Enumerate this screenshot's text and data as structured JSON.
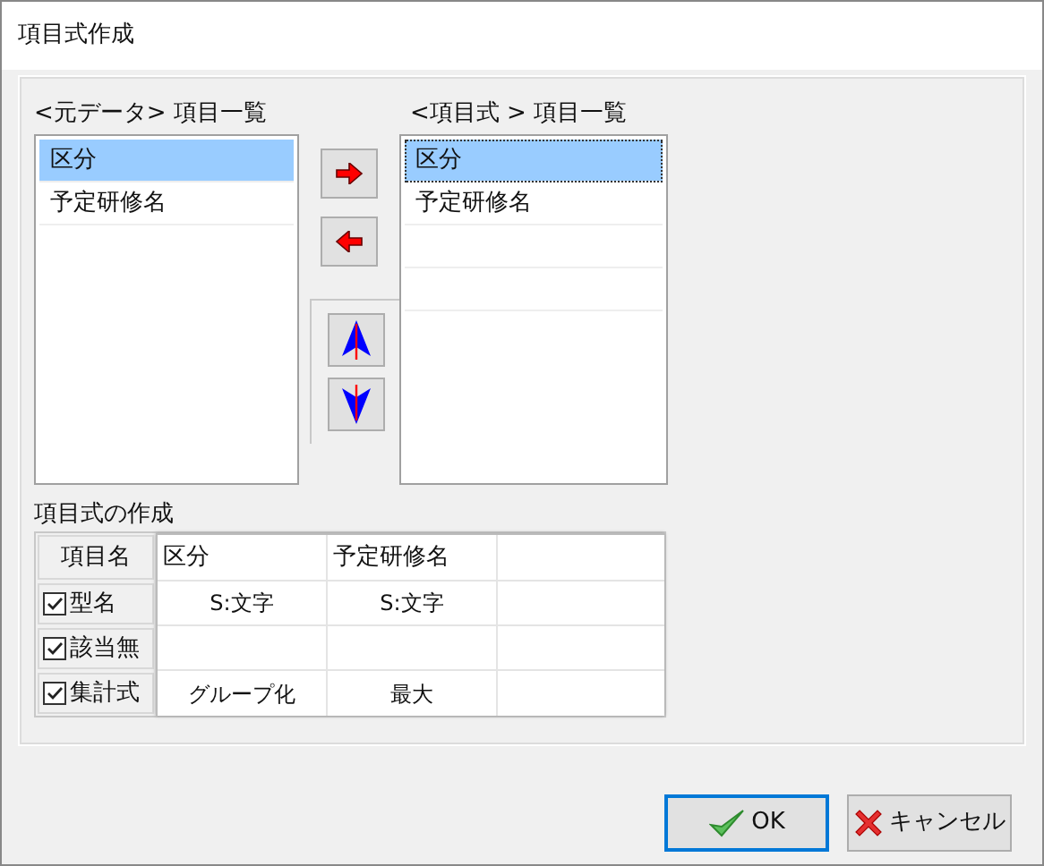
{
  "window": {
    "title": "項目式作成"
  },
  "source_list": {
    "label": "<元データ> 項目一覧",
    "items": [
      {
        "label": "区分",
        "selected": true
      },
      {
        "label": "予定研修名",
        "selected": false
      }
    ]
  },
  "target_list": {
    "label": "<項目式 > 項目一覧",
    "focused": true,
    "items": [
      {
        "label": "区分",
        "selected": true
      },
      {
        "label": "予定研修名",
        "selected": false
      }
    ]
  },
  "formula": {
    "label": "項目式の作成",
    "header_label": "項目名",
    "columns": [
      "区分",
      "予定研修名"
    ],
    "rows": [
      {
        "label": "型名",
        "checked": true,
        "cells": [
          "S:文字",
          "S:文字"
        ]
      },
      {
        "label": "該当無",
        "checked": true
      },
      {
        "label": "集計式",
        "checked": true,
        "cells": [
          "グループ化",
          "最大"
        ]
      }
    ]
  },
  "buttons": [
    {
      "kind": "ok",
      "label": "OK",
      "default": true
    },
    {
      "kind": "cancel",
      "label": "キャンセル",
      "default": false
    }
  ]
}
